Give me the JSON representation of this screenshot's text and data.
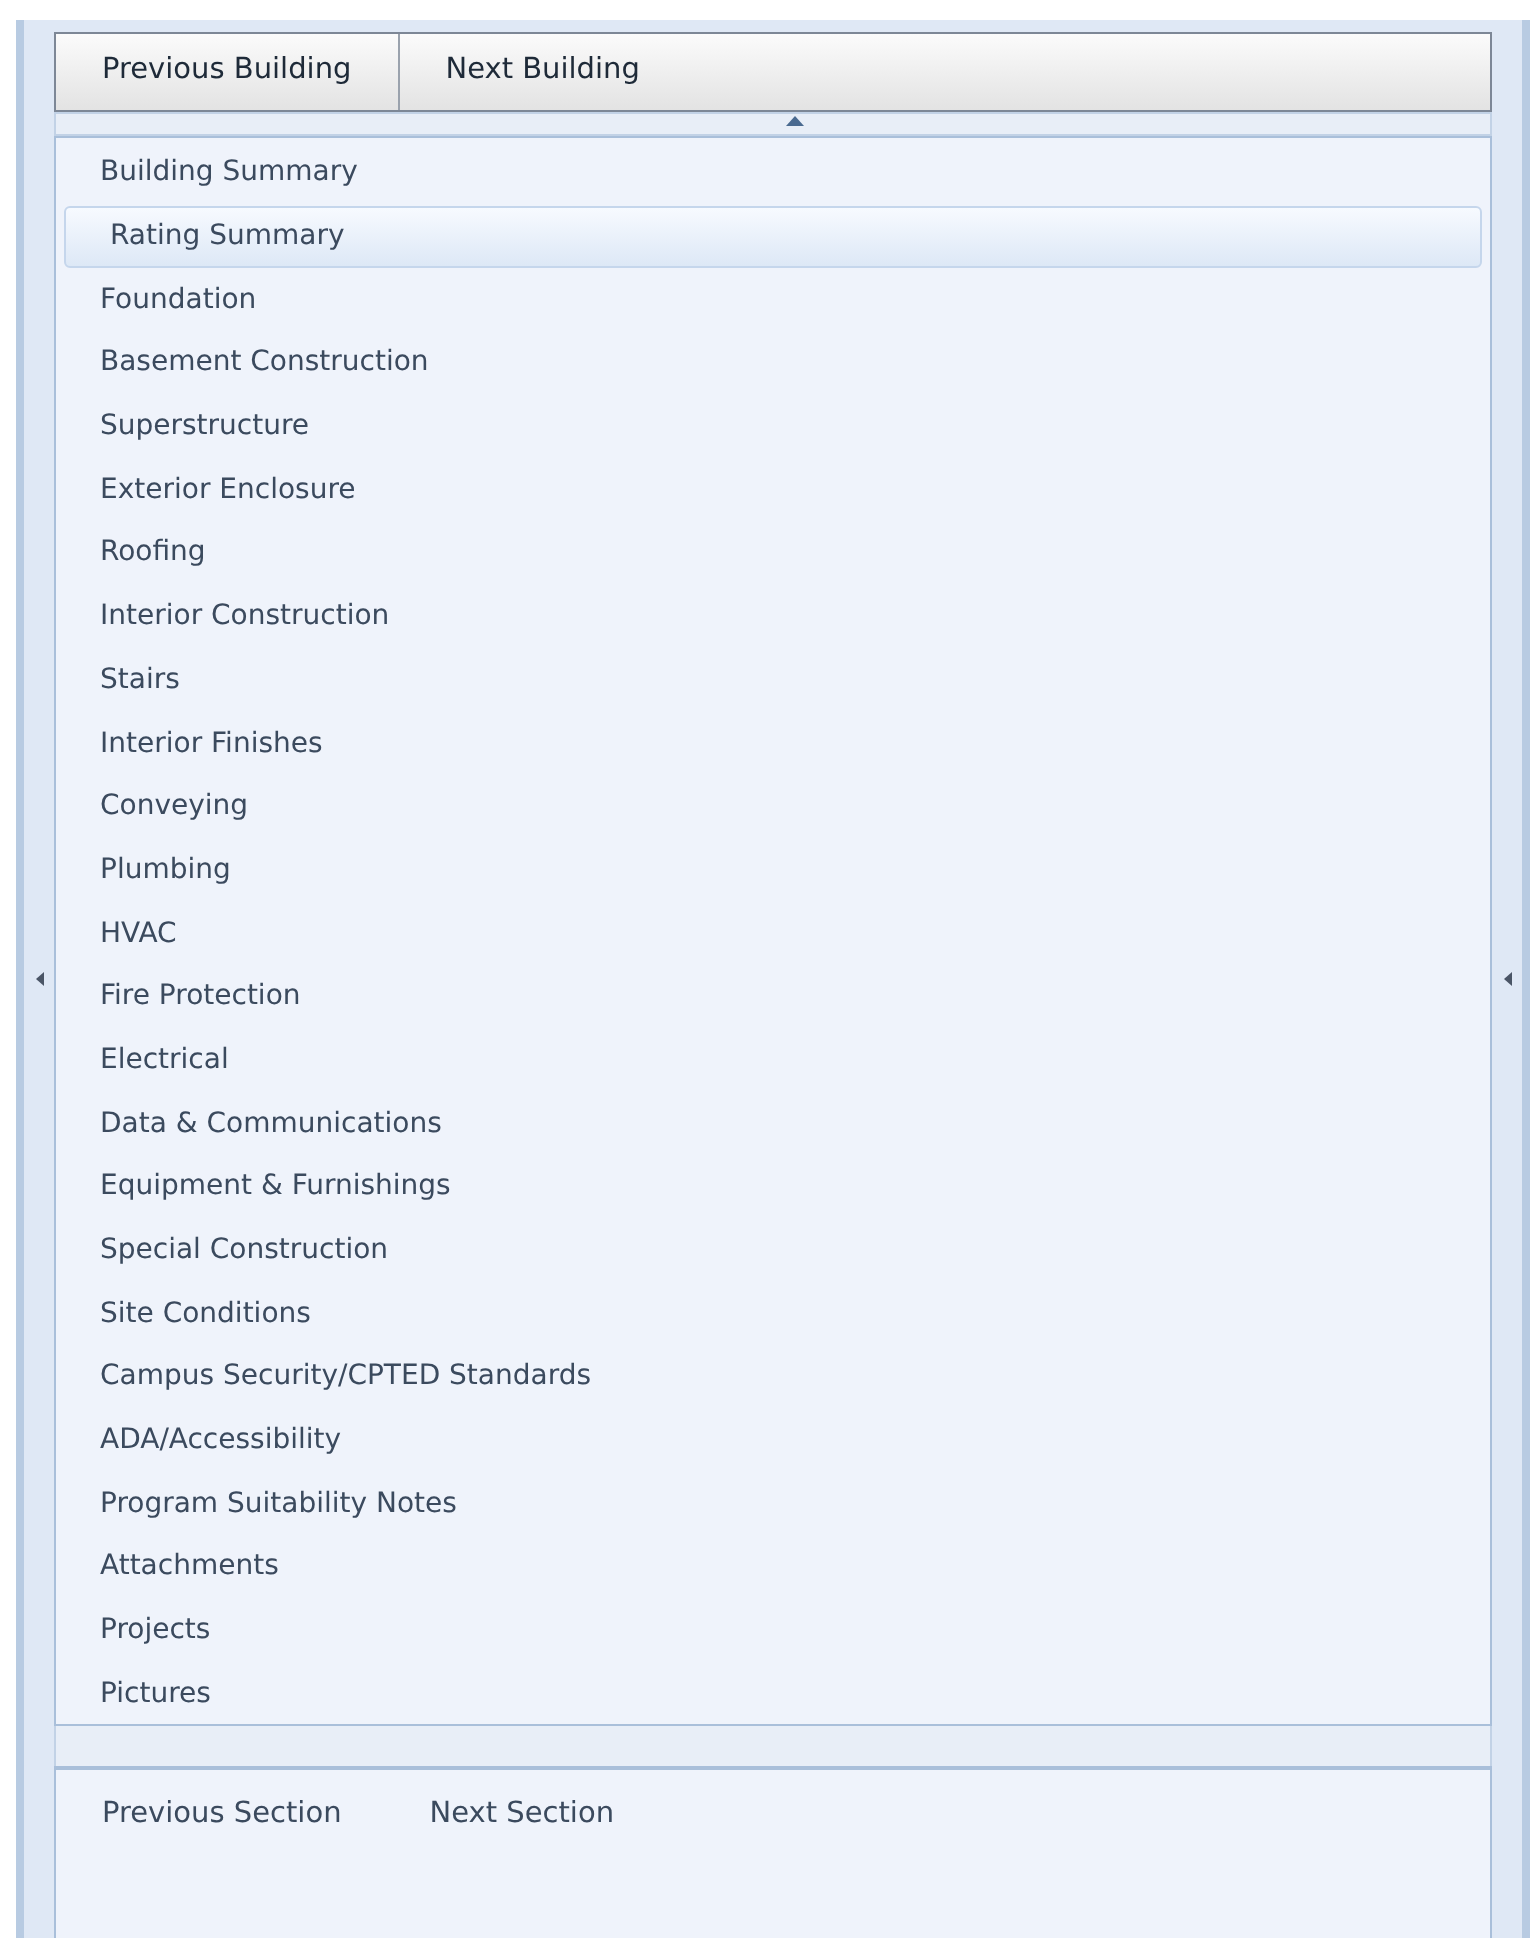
{
  "building_nav": [
    "Previous Building",
    "Next Building"
  ],
  "sections": [
    {
      "label": "Building Summary",
      "selected": false
    },
    {
      "label": "Rating Summary",
      "selected": true
    },
    {
      "label": "Foundation",
      "selected": false
    },
    {
      "label": "Basement Construction",
      "selected": false
    },
    {
      "label": "Superstructure",
      "selected": false
    },
    {
      "label": "Exterior Enclosure",
      "selected": false
    },
    {
      "label": "Roofing",
      "selected": false
    },
    {
      "label": "Interior Construction",
      "selected": false
    },
    {
      "label": "Stairs",
      "selected": false
    },
    {
      "label": "Interior Finishes",
      "selected": false
    },
    {
      "label": "Conveying",
      "selected": false
    },
    {
      "label": "Plumbing",
      "selected": false
    },
    {
      "label": "HVAC",
      "selected": false
    },
    {
      "label": "Fire Protection",
      "selected": false
    },
    {
      "label": "Electrical",
      "selected": false
    },
    {
      "label": "Data & Communications",
      "selected": false
    },
    {
      "label": "Equipment & Furnishings",
      "selected": false
    },
    {
      "label": "Special Construction",
      "selected": false
    },
    {
      "label": "Site Conditions",
      "selected": false
    },
    {
      "label": "Campus Security/CPTED Standards",
      "selected": false
    },
    {
      "label": "ADA/Accessibility",
      "selected": false
    },
    {
      "label": "Program Suitability Notes",
      "selected": false
    },
    {
      "label": "Attachments",
      "selected": false
    },
    {
      "label": "Projects",
      "selected": false
    },
    {
      "label": "Pictures",
      "selected": false
    }
  ],
  "section_nav": [
    "Previous Section",
    "Next Section"
  ]
}
